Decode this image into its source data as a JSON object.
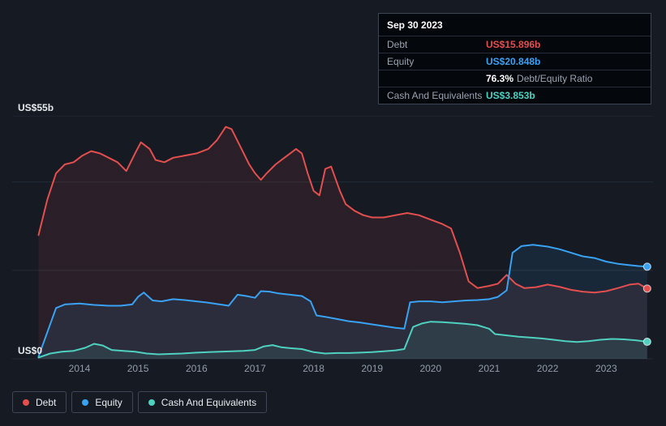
{
  "tooltip": {
    "date": "Sep 30 2023",
    "debt": {
      "label": "Debt",
      "value": "US$15.896b",
      "color": "#e34f4f"
    },
    "equity": {
      "label": "Equity",
      "value": "US$20.848b",
      "color": "#39a2f3"
    },
    "ratio": {
      "pct": "76.3%",
      "label": "Debt/Equity Ratio"
    },
    "cash": {
      "label": "Cash And Equivalents",
      "value": "US$3.853b",
      "color": "#4fd1c0"
    }
  },
  "axis": {
    "y_top": "US$55b",
    "y_bottom": "US$0"
  },
  "legend": {
    "items": [
      {
        "label": "Debt",
        "color": "#e34f4f"
      },
      {
        "label": "Equity",
        "color": "#39a2f3"
      },
      {
        "label": "Cash And Equivalents",
        "color": "#4fd1c0"
      }
    ]
  },
  "colors": {
    "background": "#151a23",
    "gridline": "#252c37",
    "tick_text": "#949ca8",
    "tooltip_bg": "#04070c",
    "border": "#3e4654"
  },
  "chart_data": {
    "type": "area",
    "x_range": [
      2012.85,
      2023.8
    ],
    "ylim": [
      0,
      55
    ],
    "y_gridlines": [
      0,
      20,
      40,
      55
    ],
    "x_ticks": [
      "2014",
      "2015",
      "2016",
      "2017",
      "2018",
      "2019",
      "2020",
      "2021",
      "2022",
      "2023"
    ],
    "series": [
      {
        "name": "Debt",
        "color": "#e34f4f",
        "x": [
          2013.3,
          2013.45,
          2013.6,
          2013.75,
          2013.9,
          2014.05,
          2014.2,
          2014.35,
          2014.5,
          2014.65,
          2014.8,
          2014.95,
          2015.05,
          2015.2,
          2015.3,
          2015.45,
          2015.6,
          2015.8,
          2016.0,
          2016.2,
          2016.35,
          2016.5,
          2016.6,
          2016.75,
          2016.9,
          2017.0,
          2017.1,
          2017.2,
          2017.35,
          2017.5,
          2017.6,
          2017.7,
          2017.8,
          2017.9,
          2018.0,
          2018.1,
          2018.2,
          2018.3,
          2018.45,
          2018.55,
          2018.7,
          2018.85,
          2019.0,
          2019.2,
          2019.4,
          2019.6,
          2019.8,
          2020.0,
          2020.2,
          2020.35,
          2020.5,
          2020.65,
          2020.8,
          2021.0,
          2021.15,
          2021.3,
          2021.45,
          2021.6,
          2021.8,
          2022.0,
          2022.2,
          2022.4,
          2022.6,
          2022.8,
          2023.0,
          2023.2,
          2023.4,
          2023.55,
          2023.7
        ],
        "values": [
          28,
          36,
          42,
          44,
          44.5,
          46,
          47,
          46.5,
          45.5,
          44.5,
          42.5,
          46.5,
          49,
          47.5,
          45,
          44.5,
          45.5,
          46,
          46.5,
          47.5,
          49.5,
          52.5,
          52,
          48,
          44,
          42,
          40.5,
          42,
          44,
          45.5,
          46.5,
          47.5,
          46.5,
          42,
          38,
          37,
          43,
          43.5,
          38,
          35,
          33.5,
          32.5,
          32,
          32,
          32.5,
          33,
          32.5,
          31.5,
          30.5,
          29.5,
          24,
          17.5,
          16,
          16.5,
          17,
          19,
          17,
          16,
          16.2,
          16.8,
          16.3,
          15.6,
          15.2,
          15,
          15.3,
          16,
          16.8,
          17,
          15.896
        ]
      },
      {
        "name": "Equity",
        "color": "#39a2f3",
        "x": [
          2013.3,
          2013.45,
          2013.6,
          2013.75,
          2014.0,
          2014.25,
          2014.5,
          2014.7,
          2014.9,
          2015.0,
          2015.1,
          2015.25,
          2015.4,
          2015.6,
          2015.8,
          2016.0,
          2016.2,
          2016.4,
          2016.55,
          2016.7,
          2016.85,
          2017.0,
          2017.1,
          2017.25,
          2017.4,
          2017.6,
          2017.8,
          2017.95,
          2018.05,
          2018.2,
          2018.4,
          2018.6,
          2018.8,
          2019.0,
          2019.2,
          2019.4,
          2019.55,
          2019.65,
          2019.8,
          2020.0,
          2020.2,
          2020.4,
          2020.6,
          2020.8,
          2021.0,
          2021.15,
          2021.3,
          2021.4,
          2021.55,
          2021.75,
          2022.0,
          2022.2,
          2022.4,
          2022.6,
          2022.8,
          2023.0,
          2023.2,
          2023.4,
          2023.55,
          2023.7
        ],
        "values": [
          0.5,
          6,
          11.5,
          12.3,
          12.5,
          12.2,
          12,
          12,
          12.3,
          14,
          15,
          13.2,
          13,
          13.5,
          13.3,
          13,
          12.7,
          12.3,
          12,
          14.5,
          14.2,
          13.8,
          15.3,
          15.2,
          14.8,
          14.5,
          14.2,
          13,
          9.8,
          9.5,
          9,
          8.5,
          8.2,
          7.8,
          7.4,
          7,
          6.8,
          12.8,
          13,
          13,
          12.8,
          13,
          13.2,
          13.3,
          13.5,
          14,
          15.5,
          24,
          25.5,
          25.8,
          25.4,
          24.8,
          24,
          23.2,
          22.8,
          22,
          21.5,
          21.2,
          21,
          20.848
        ]
      },
      {
        "name": "Cash And Equivalents",
        "color": "#4fd1c0",
        "x": [
          2013.3,
          2013.5,
          2013.7,
          2013.9,
          2014.1,
          2014.25,
          2014.4,
          2014.55,
          2014.75,
          2014.95,
          2015.15,
          2015.35,
          2015.55,
          2015.75,
          2016.0,
          2016.2,
          2016.4,
          2016.6,
          2016.8,
          2017.0,
          2017.15,
          2017.3,
          2017.45,
          2017.6,
          2017.8,
          2018.0,
          2018.2,
          2018.4,
          2018.6,
          2018.8,
          2019.0,
          2019.2,
          2019.4,
          2019.55,
          2019.7,
          2019.85,
          2020.0,
          2020.2,
          2020.4,
          2020.6,
          2020.8,
          2021.0,
          2021.1,
          2021.3,
          2021.5,
          2021.7,
          2021.9,
          2022.1,
          2022.3,
          2022.5,
          2022.7,
          2022.9,
          2023.1,
          2023.3,
          2023.5,
          2023.7
        ],
        "values": [
          0.3,
          1.2,
          1.6,
          1.8,
          2.5,
          3.4,
          3,
          2,
          1.8,
          1.6,
          1.2,
          1,
          1.1,
          1.2,
          1.4,
          1.5,
          1.6,
          1.7,
          1.8,
          2,
          2.8,
          3.1,
          2.6,
          2.4,
          2.2,
          1.5,
          1.2,
          1.3,
          1.3,
          1.4,
          1.5,
          1.7,
          1.9,
          2.2,
          7.2,
          8,
          8.4,
          8.3,
          8.1,
          7.9,
          7.6,
          6.8,
          5.6,
          5.3,
          5,
          4.8,
          4.6,
          4.3,
          4,
          3.8,
          4,
          4.3,
          4.5,
          4.4,
          4.2,
          3.853
        ]
      }
    ]
  }
}
